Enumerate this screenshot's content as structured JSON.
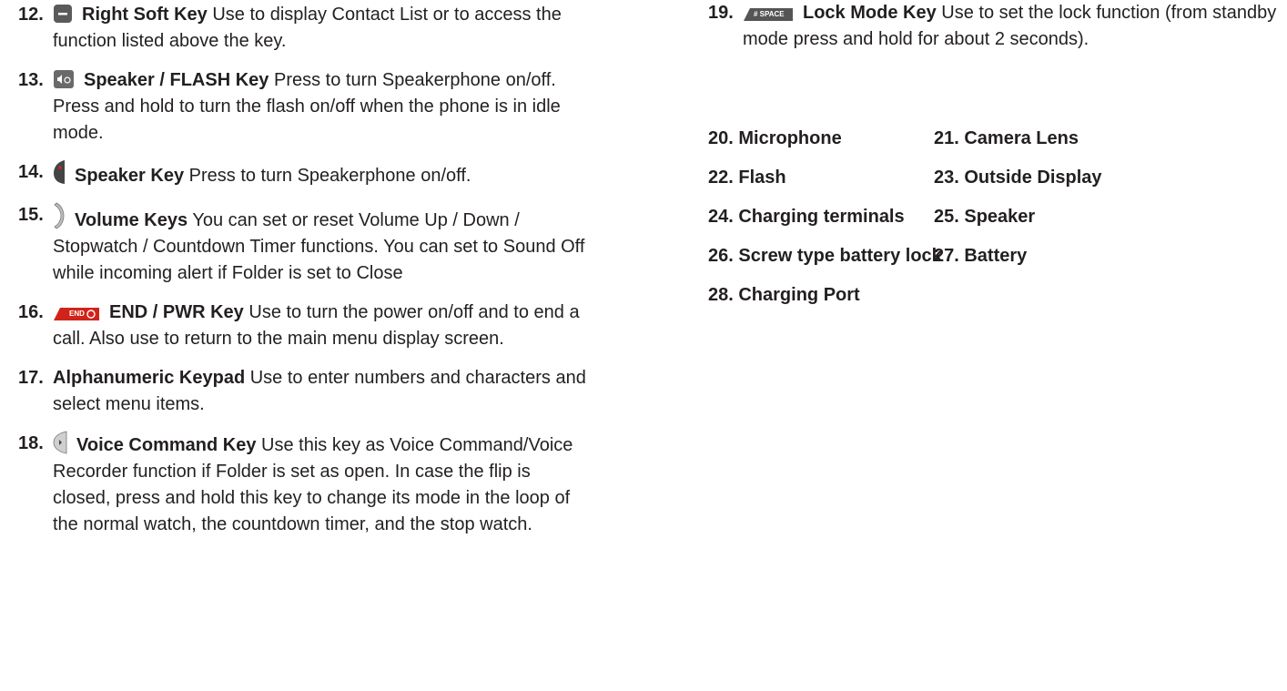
{
  "left_items": [
    {
      "num": "12.",
      "icon": "right-soft-key-icon",
      "title": "Right Soft Key",
      "desc": " Use to display Contact List or to access the function listed above the key."
    },
    {
      "num": "13.",
      "icon": "speaker-flash-key-icon",
      "title": "Speaker / FLASH Key",
      "desc": " Press to turn Speakerphone on/off. Press and hold to turn the flash on/off when the phone is in idle mode."
    },
    {
      "num": "14.",
      "icon": "speaker-key-icon",
      "title": "Speaker Key",
      "desc": "  Press to turn Speakerphone on/off."
    },
    {
      "num": "15.",
      "icon": "volume-keys-icon",
      "title": "Volume Keys",
      "desc": " You can set or reset Volume Up / Down / Stopwatch / Countdown Timer functions. You can set to Sound Off while incoming alert if Folder is set to Close"
    },
    {
      "num": "16.",
      "icon": "end-pwr-key-icon",
      "icon_text": "END",
      "title": "END / PWR Key",
      "desc": " Use to turn the power on/off and to end a call. Also use to return to the main menu display screen."
    },
    {
      "num": "17.",
      "icon": "",
      "title": "Alphanumeric Keypad",
      "desc": " Use to enter numbers and characters and select menu items."
    },
    {
      "num": "18.",
      "icon": "voice-command-key-icon",
      "title": "Voice Command Key",
      "desc": " Use this key as Voice Command/Voice Recorder function if Folder is set as open. In case the flip is closed, press and hold this key to change its mode in the loop of the normal watch, the countdown timer, and the stop watch."
    }
  ],
  "right_item": {
    "num": "19.",
    "icon": "lock-mode-key-icon",
    "icon_text": "# SPACE",
    "title": "Lock Mode Key",
    "desc": " Use to set the lock function (from standby mode press and hold for about 2 seconds)."
  },
  "parts_grid": [
    [
      "20. Microphone",
      "21. Camera Lens"
    ],
    [
      "22. Flash",
      "23. Outside Display"
    ],
    [
      "24. Charging terminals",
      "25. Speaker"
    ],
    [
      "26. Screw type battery lock",
      "27. Battery"
    ],
    [
      "28. Charging Port",
      ""
    ]
  ]
}
